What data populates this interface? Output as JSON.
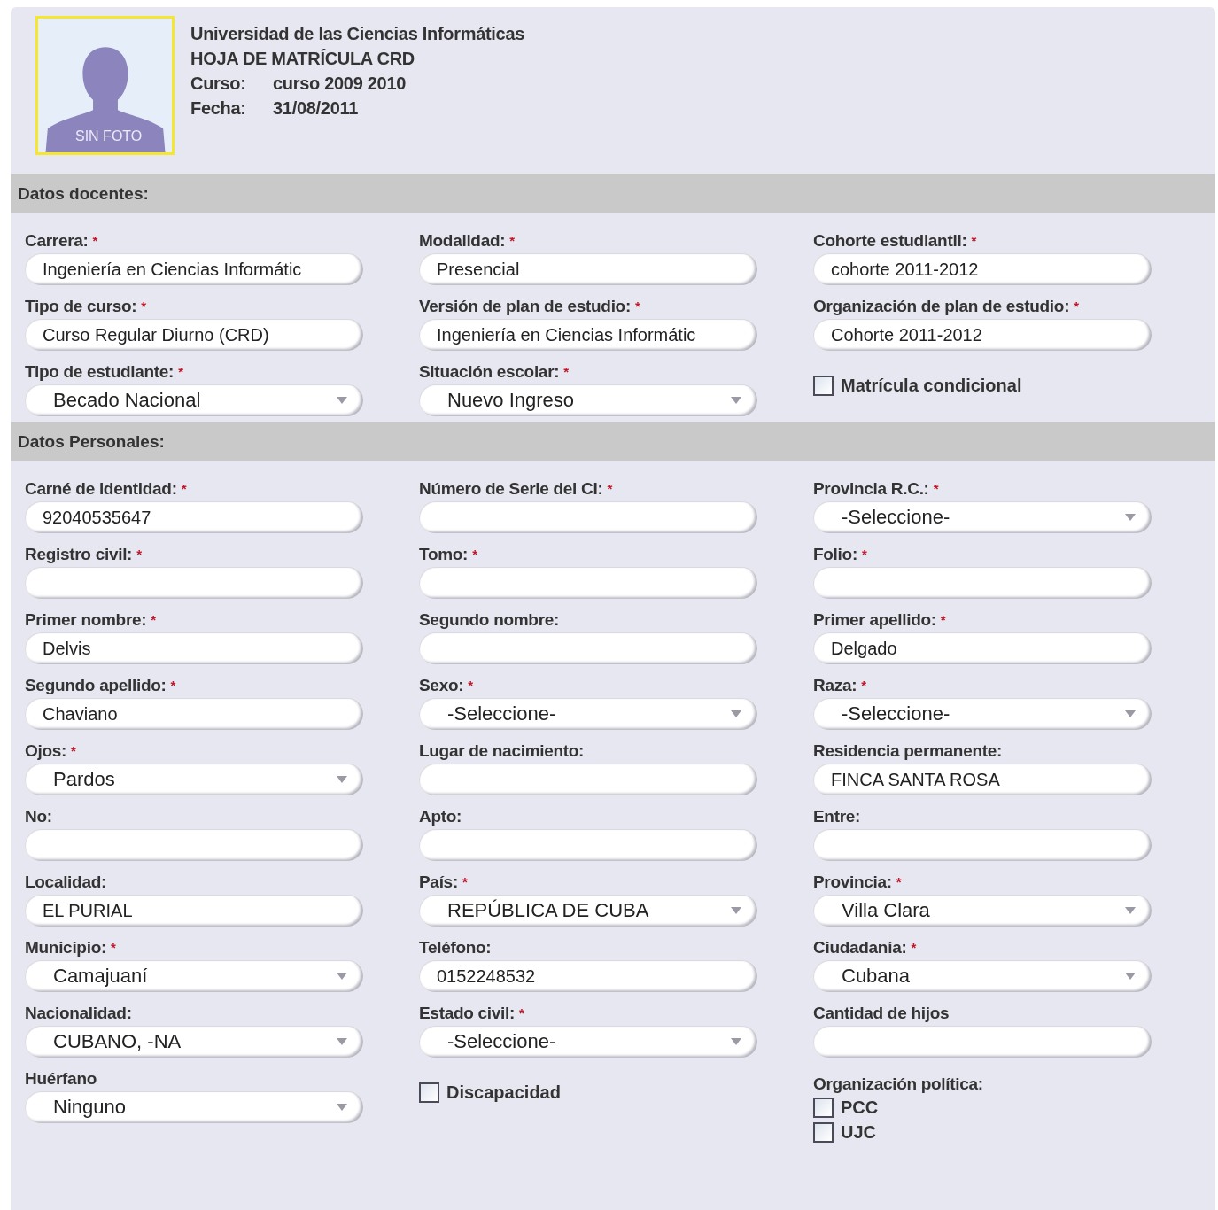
{
  "header": {
    "photo_caption": "SIN FOTO",
    "institution": "Universidad de las Ciencias Informáticas",
    "document_title": "HOJA DE MATRÍCULA CRD",
    "details": [
      {
        "label": "Curso:",
        "value": "curso 2009 2010"
      },
      {
        "label": "Fecha:",
        "value": "31/08/2011"
      }
    ]
  },
  "sections": [
    {
      "title": "Datos docentes:",
      "fields": [
        {
          "kind": "text",
          "label": "Carrera:",
          "mark": "*",
          "value": "Ingeniería en Ciencias Informátic"
        },
        {
          "kind": "text",
          "label": "Modalidad:",
          "mark": "*",
          "value": "Presencial"
        },
        {
          "kind": "text",
          "label": "Cohorte estudiantil:",
          "mark": "*",
          "value": "cohorte 2011-2012"
        },
        {
          "kind": "text",
          "label": "Tipo de curso:",
          "mark": "*",
          "value": "Curso Regular Diurno (CRD)"
        },
        {
          "kind": "text",
          "label": "Versión de plan de estudio:",
          "mark": "*",
          "value": "Ingeniería en Ciencias Informátic"
        },
        {
          "kind": "text",
          "label": "Organización de plan de estudio:",
          "mark": "*",
          "value": "Cohorte 2011-2012"
        },
        {
          "kind": "select",
          "label": "Tipo de estudiante:",
          "mark": "*",
          "value": "Becado Nacional"
        },
        {
          "kind": "select",
          "label": "Situación escolar:",
          "mark": "*",
          "value": "Nuevo Ingreso"
        },
        {
          "kind": "checkbox",
          "label": "Matrícula condicional",
          "checked": false
        }
      ]
    },
    {
      "title": "Datos Personales:",
      "fields": [
        {
          "kind": "text",
          "label": "Carné de identidad:",
          "mark": "*",
          "value": "92040535647"
        },
        {
          "kind": "text",
          "label": "Número de Serie del CI:",
          "mark": "*"
        },
        {
          "kind": "select",
          "label": "Provincia R.C.:",
          "mark": "*",
          "value": "-Seleccione-"
        },
        {
          "kind": "text",
          "label": "Registro civil:",
          "mark": "*"
        },
        {
          "kind": "text",
          "label": "Tomo:",
          "mark": "*"
        },
        {
          "kind": "text",
          "label": "Folio:",
          "mark": "*"
        },
        {
          "kind": "text",
          "label": "Primer nombre:",
          "mark": "*",
          "value": "Delvis"
        },
        {
          "kind": "text",
          "label": "Segundo nombre:"
        },
        {
          "kind": "text",
          "label": "Primer apellido:",
          "mark": "*",
          "value": "Delgado"
        },
        {
          "kind": "text",
          "label": "Segundo apellido:",
          "mark": "*",
          "value": "Chaviano"
        },
        {
          "kind": "select",
          "label": "Sexo:",
          "mark": "*",
          "value": "-Seleccione-"
        },
        {
          "kind": "select",
          "label": "Raza:",
          "mark": "*",
          "value": "-Seleccione-"
        },
        {
          "kind": "select",
          "label": "Ojos:",
          "mark": "*",
          "value": "Pardos"
        },
        {
          "kind": "text",
          "label": "Lugar de nacimiento:"
        },
        {
          "kind": "text",
          "label": "Residencia permanente:",
          "value": "FINCA SANTA ROSA"
        },
        {
          "kind": "text",
          "label": "No:"
        },
        {
          "kind": "text",
          "label": "Apto:"
        },
        {
          "kind": "text",
          "label": "Entre:"
        },
        {
          "kind": "text",
          "label": "Localidad:",
          "value": "EL PURIAL"
        },
        {
          "kind": "select",
          "label": "País:",
          "mark": "*",
          "value": "REPÚBLICA DE CUBA"
        },
        {
          "kind": "select",
          "label": "Provincia:",
          "mark": "*",
          "value": "Villa Clara"
        },
        {
          "kind": "select",
          "label": "Municipio:",
          "mark": "*",
          "value": "Camajuaní"
        },
        {
          "kind": "text",
          "label": "Teléfono:",
          "value": "0152248532"
        },
        {
          "kind": "select",
          "label": "Ciudadanía:",
          "mark": "*",
          "value": "Cubana"
        },
        {
          "kind": "select",
          "label": "Nacionalidad:",
          "value": "CUBANO, -NA"
        },
        {
          "kind": "select",
          "label": "Estado civil:",
          "mark": "*",
          "value": "-Seleccione-"
        },
        {
          "kind": "text",
          "label": "Cantidad de hijos"
        },
        {
          "kind": "select",
          "label": "Huérfano",
          "value": "Ninguno"
        },
        {
          "kind": "checkbox",
          "label": "Discapacidad",
          "checked": false
        },
        {
          "kind": "checkgroup",
          "label": "Organización política:",
          "options": [
            {
              "label": "PCC",
              "checked": false
            },
            {
              "label": "UJC",
              "checked": false
            }
          ]
        }
      ]
    }
  ]
}
